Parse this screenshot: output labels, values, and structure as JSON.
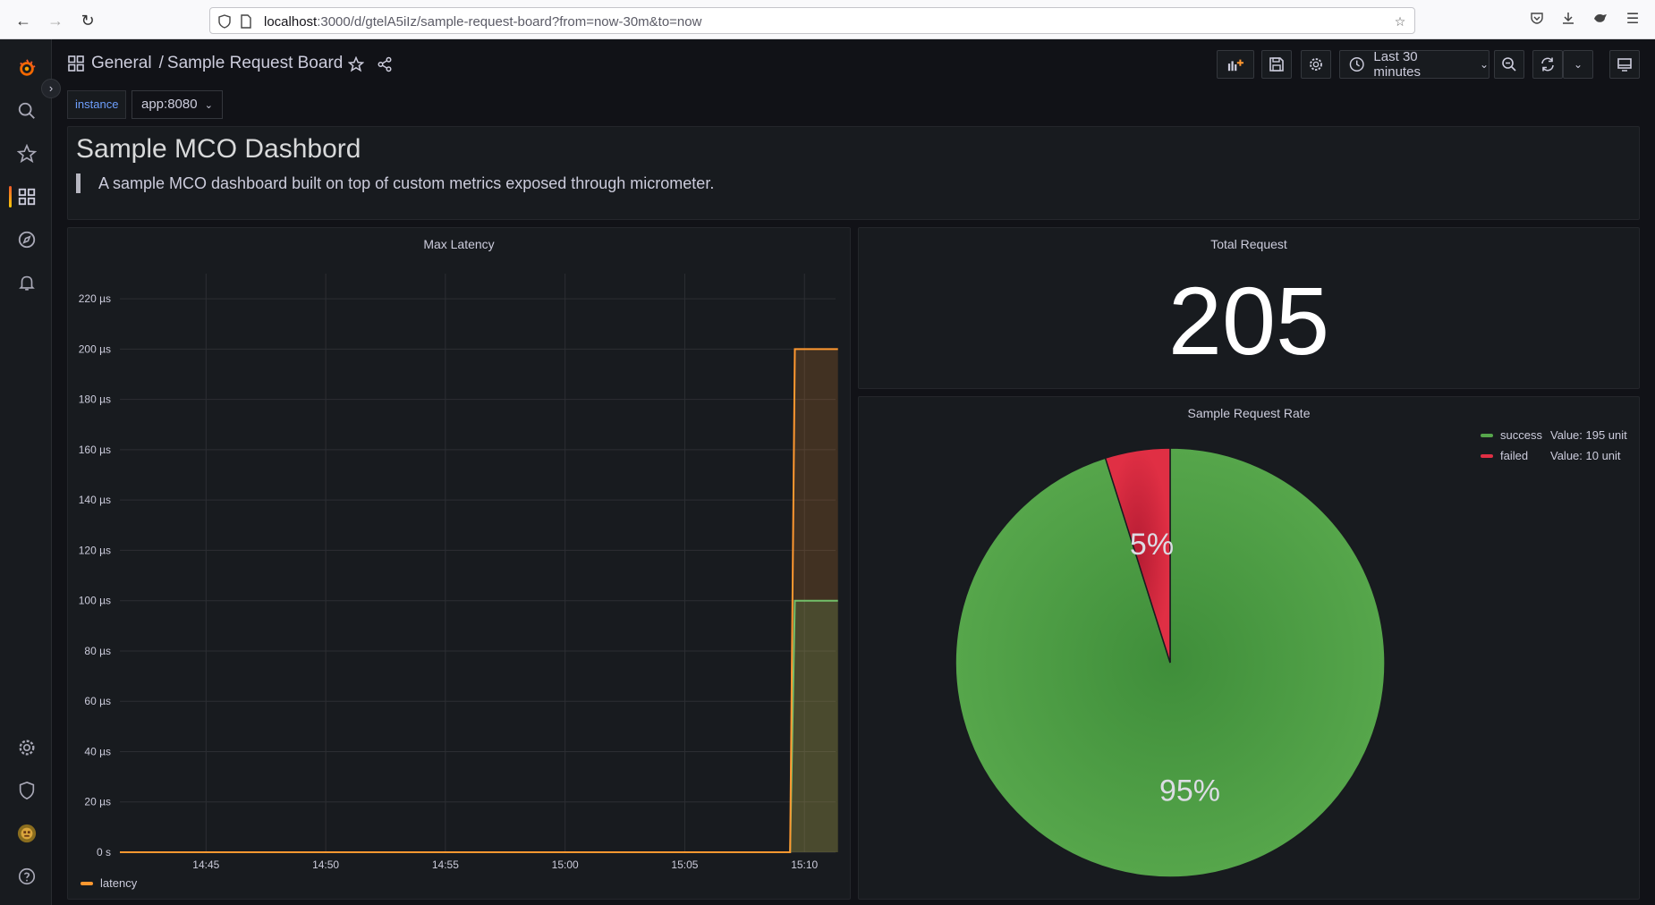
{
  "browser": {
    "url_host": "localhost",
    "url_path": ":3000/d/gtelA5iIz/sample-request-board?from=now-30m&to=now"
  },
  "breadcrumb": {
    "folder": "General",
    "separator": "/",
    "dashboard": "Sample Request Board"
  },
  "toolbar": {
    "time_range": "Last 30 minutes"
  },
  "variables": {
    "label": "instance",
    "value": "app:8080"
  },
  "text_panel": {
    "heading": "Sample MCO Dashbord",
    "description": "A sample MCO dashboard built on top of custom metrics exposed through micrometer."
  },
  "latency_panel": {
    "title": "Max Latency"
  },
  "total_panel": {
    "title": "Total Request",
    "value": "205"
  },
  "rate_panel": {
    "title": "Sample Request Rate",
    "legend": [
      {
        "name": "success",
        "value_text": "Value: 195 unit",
        "color": "#56a64b"
      },
      {
        "name": "failed",
        "value_text": "Value: 10 unit",
        "color": "#e02f44"
      }
    ]
  },
  "chart_data": [
    {
      "type": "line",
      "title": "Max Latency",
      "x": [
        "14:45",
        "14:50",
        "14:55",
        "15:00",
        "15:05",
        "15:10"
      ],
      "xlim_minutes": [
        "14:41.4",
        "15:11.3"
      ],
      "y_ticks": [
        "0 s",
        "20 µs",
        "40 µs",
        "60 µs",
        "80 µs",
        "100 µs",
        "120 µs",
        "140 µs",
        "160 µs",
        "180 µs",
        "200 µs",
        "220 µs"
      ],
      "ylim": [
        0,
        230
      ],
      "grid": true,
      "legend": "bottom-left",
      "series": [
        {
          "name": "latency",
          "color": "#ff9830",
          "points": [
            [
              0,
              0
            ],
            [
              28.0,
              0
            ],
            [
              28.2,
              200
            ],
            [
              30.0,
              200
            ]
          ]
        },
        {
          "color": "#73bf69",
          "points": [
            [
              0,
              0
            ],
            [
              28.0,
              0
            ],
            [
              28.2,
              100
            ],
            [
              30.0,
              100
            ]
          ]
        }
      ]
    },
    {
      "type": "pie",
      "title": "Sample Request Rate",
      "categories": [
        "success",
        "failed"
      ],
      "values": [
        195,
        10
      ],
      "labels": [
        "95%",
        "5%"
      ],
      "colors": [
        "#56a64b",
        "#e02f44"
      ],
      "legend": "top-right"
    }
  ]
}
